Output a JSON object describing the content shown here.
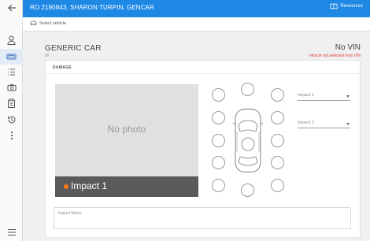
{
  "header": {
    "title": "RO 2190843, SHARON TURPIN, GENCAR",
    "resources_label": "Resources"
  },
  "toolbar": {
    "select_vehicle_label": "Select vehicle"
  },
  "vehicle": {
    "name": "GENERIC CAR",
    "vin": "No VIN",
    "vin_warning": "Vehicle not selected from VIN"
  },
  "damage": {
    "section_label": "DAMAGE",
    "photo_placeholder": "No photo",
    "photo_caption": "Impact 1",
    "impact1_placeholder": "Impact 1",
    "impact2_placeholder": "Impact 2",
    "notes_placeholder": "Impact Notes",
    "accent_color": "#ff7a1a"
  },
  "sidebar": {
    "items": [
      "back-arrow-icon",
      "customer-icon",
      "vehicle-icon",
      "checklist-icon",
      "camera-icon",
      "clipboard-icon",
      "history-icon",
      "more-icon",
      "menu-icon"
    ]
  },
  "colors": {
    "primary": "#1e88e5",
    "warning": "#e53935"
  }
}
